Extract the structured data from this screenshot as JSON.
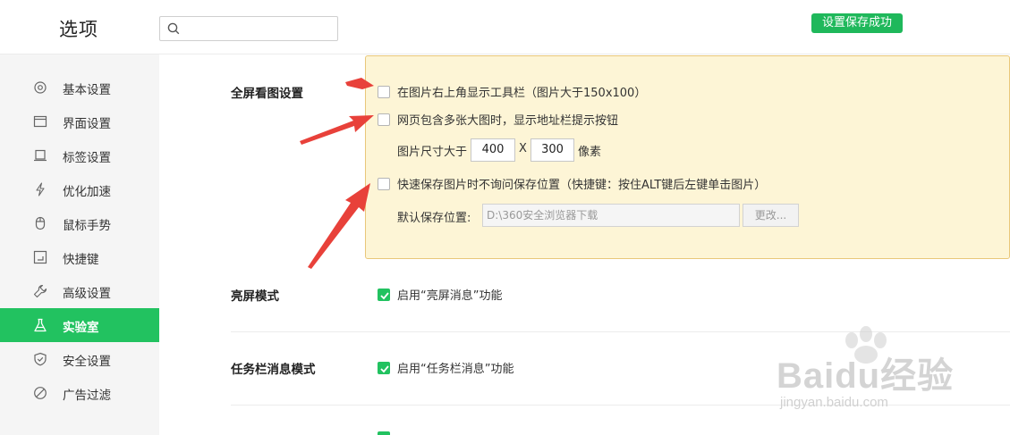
{
  "header": {
    "title": "选项",
    "search_placeholder": "",
    "toast": "设置保存成功"
  },
  "sidebar": {
    "items": [
      {
        "label": "基本设置",
        "icon": "gear-icon"
      },
      {
        "label": "界面设置",
        "icon": "window-icon"
      },
      {
        "label": "标签设置",
        "icon": "tab-icon"
      },
      {
        "label": "优化加速",
        "icon": "lightning-icon"
      },
      {
        "label": "鼠标手势",
        "icon": "mouse-icon"
      },
      {
        "label": "快捷键",
        "icon": "keyboard-icon"
      },
      {
        "label": "高级设置",
        "icon": "wrench-icon"
      },
      {
        "label": "实验室",
        "icon": "flask-icon",
        "active": true
      },
      {
        "label": "安全设置",
        "icon": "shield-icon"
      },
      {
        "label": "广告过滤",
        "icon": "block-icon"
      }
    ]
  },
  "fullscreen": {
    "title": "全屏看图设置",
    "opt_toolbar": "在图片右上角显示工具栏（图片大于150x100）",
    "opt_address": "网页包含多张大图时，显示地址栏提示按钮",
    "size_label": "图片尺寸大于",
    "width": "400",
    "x": "X",
    "height": "300",
    "unit": "像素",
    "opt_quicksave": "快速保存图片时不询问保存位置（快捷键：按住ALT键后左键单击图片）",
    "save_label": "默认保存位置:",
    "save_path": "D:\\360安全浏览器下载",
    "change_button": "更改..."
  },
  "bright": {
    "title": "亮屏模式",
    "option": "启用“亮屏消息”功能"
  },
  "taskbar": {
    "title": "任务栏消息模式",
    "option": "启用“任务栏消息”功能"
  },
  "watermark": {
    "brand": "Baidu经验",
    "url": "jingyan.baidu.com"
  },
  "colors": {
    "accent": "#22c260",
    "highlight_bg": "#fdf5d6",
    "arrow": "#e8413a"
  }
}
